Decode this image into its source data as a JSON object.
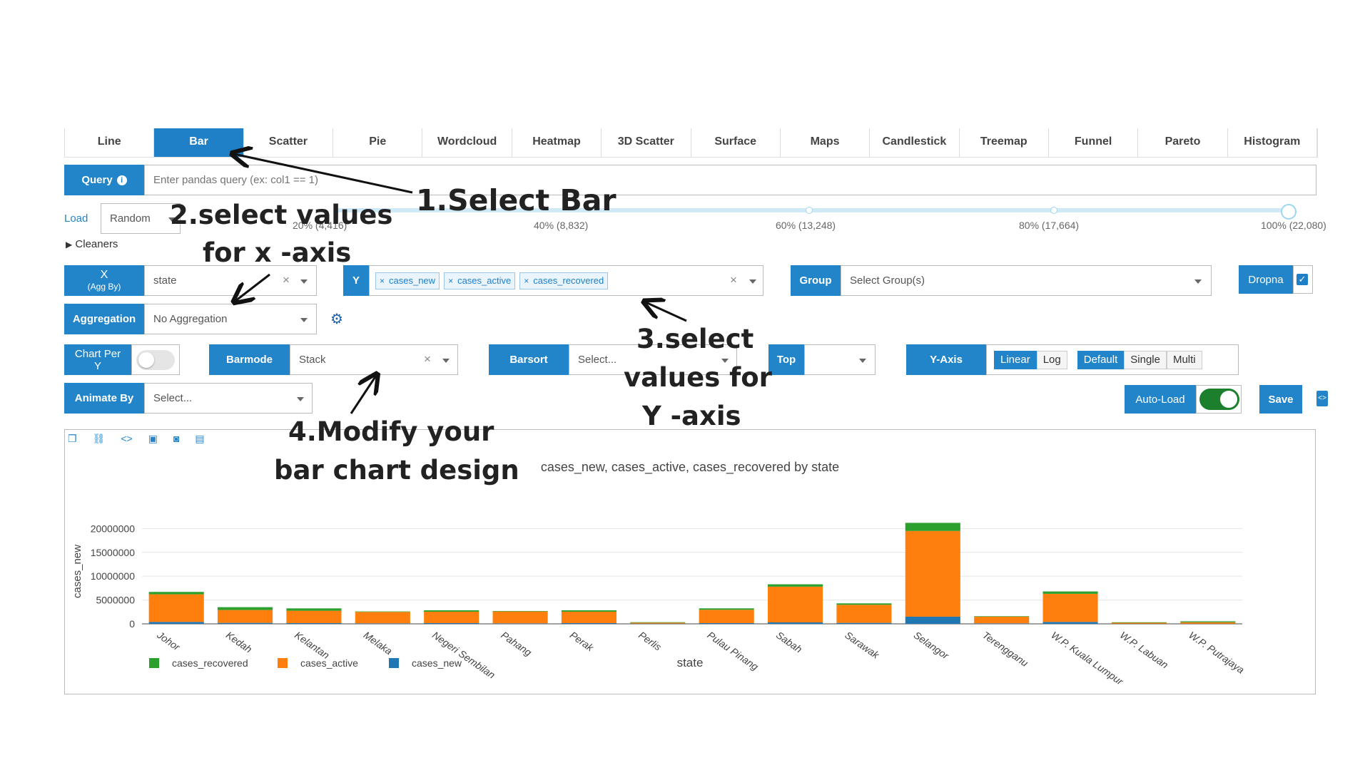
{
  "tabs": [
    "Line",
    "Bar",
    "Scatter",
    "Pie",
    "Wordcloud",
    "Heatmap",
    "3D Scatter",
    "Surface",
    "Maps",
    "Candlestick",
    "Treemap",
    "Funnel",
    "Pareto",
    "Histogram"
  ],
  "active_tab": "Bar",
  "query": {
    "label": "Query",
    "placeholder": "Enter pandas query (ex: col1 == 1)"
  },
  "load": {
    "label": "Load",
    "value": "Random"
  },
  "slider": {
    "ticks": [
      "20% (4,416)",
      "40% (8,832)",
      "60% (13,248)",
      "80% (17,664)",
      "100% (22,080)"
    ]
  },
  "cleaners": "Cleaners",
  "x": {
    "label": "X",
    "sub": "(Agg By)",
    "value": "state"
  },
  "y": {
    "label": "Y",
    "chips": [
      "cases_new",
      "cases_active",
      "cases_recovered"
    ]
  },
  "group": {
    "label": "Group",
    "placeholder": "Select Group(s)"
  },
  "dropna": {
    "label": "Dropna",
    "checked": true
  },
  "aggregation": {
    "label": "Aggregation",
    "value": "No Aggregation"
  },
  "chart_per_y": {
    "label1": "Chart Per",
    "label2": "Y"
  },
  "barmode": {
    "label": "Barmode",
    "value": "Stack"
  },
  "barsort": {
    "label": "Barsort",
    "placeholder": "Select..."
  },
  "top": {
    "label": "Top"
  },
  "yaxis": {
    "label": "Y-Axis",
    "scale": [
      "Linear",
      "Log"
    ],
    "mode": [
      "Default",
      "Single",
      "Multi"
    ]
  },
  "animate_by": {
    "label": "Animate By",
    "placeholder": "Select..."
  },
  "auto_load": "Auto-Load",
  "save": "Save",
  "annotations": {
    "a1": "1.Select Bar",
    "a2_l1": "2.select values",
    "a2_l2": "for x -axis",
    "a3_l1": "3.select",
    "a3_l2": "values for",
    "a3_l3": "Y -axis",
    "a4_l1": "4.Modify your",
    "a4_l2": "bar chart design"
  },
  "chart_data": {
    "type": "bar",
    "barmode": "stack",
    "title": "cases_new, cases_active, cases_recovered by state",
    "xlabel": "state",
    "ylabel": "cases_new",
    "ylim": [
      0,
      22000000
    ],
    "yticks": [
      0,
      5000000,
      10000000,
      15000000,
      20000000
    ],
    "categories": [
      "Johor",
      "Kedah",
      "Kelantan",
      "Melaka",
      "Negeri Sembilan",
      "Pahang",
      "Perak",
      "Perlis",
      "Pulau Pinang",
      "Sabah",
      "Sarawak",
      "Selangor",
      "Terengganu",
      "W.P. Kuala Lumpur",
      "W.P. Labuan",
      "W.P. Putrajaya"
    ],
    "series": [
      {
        "name": "cases_new",
        "color": "#1f77b4",
        "values": [
          400000,
          200000,
          150000,
          100000,
          150000,
          100000,
          150000,
          50000,
          150000,
          300000,
          200000,
          1500000,
          100000,
          400000,
          30000,
          30000
        ]
      },
      {
        "name": "cases_active",
        "color": "#ff7f0e",
        "values": [
          5800000,
          2700000,
          2600000,
          2400000,
          2400000,
          2500000,
          2400000,
          200000,
          2800000,
          7500000,
          3800000,
          18000000,
          1400000,
          5900000,
          200000,
          300000
        ]
      },
      {
        "name": "cases_recovered",
        "color": "#2ca02c",
        "values": [
          500000,
          600000,
          500000,
          100000,
          300000,
          100000,
          300000,
          100000,
          300000,
          500000,
          300000,
          1700000,
          100000,
          500000,
          100000,
          200000
        ]
      }
    ],
    "legend": [
      "cases_recovered",
      "cases_active",
      "cases_new"
    ],
    "legend_position": "bottom-left"
  }
}
